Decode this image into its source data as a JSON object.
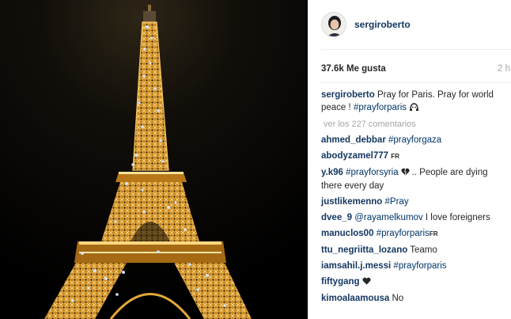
{
  "post": {
    "username": "sergiroberto",
    "likes": "37.6k Me gusta",
    "time_ago": "2 h",
    "caption": {
      "text": "Pray for Paris. Pray for world peace !",
      "hashtag": "#prayforparis"
    },
    "view_comments": "ver los 227 comentarios"
  },
  "comments": [
    {
      "user": "ahmed_debbar",
      "hashtag": "#prayforgaza",
      "text": ""
    },
    {
      "user": "abodyzamel777",
      "badge": "FR"
    },
    {
      "user": "y.k96",
      "hashtag": "#prayforsyria",
      "text": ".. People are dying there every day",
      "icon": "broken-heart-icon"
    },
    {
      "user": "justlikemenno",
      "hashtag": "#Pray"
    },
    {
      "user": "dvee_9",
      "mention": "@rayamelkumov",
      "text": "I love foreigners"
    },
    {
      "user": "manuclos00",
      "hashtag": "#prayforparis",
      "badge": "FR"
    },
    {
      "user": "ttu_negriitta_lozano",
      "text": "Teamo"
    },
    {
      "user": "iamsahil.j.messi",
      "hashtag": "#prayforparis"
    },
    {
      "user": "fiftygang",
      "icon": "black-heart-icon"
    },
    {
      "user": "kimoalaamousa",
      "text": "No"
    }
  ],
  "colors": {
    "username": "#12365f",
    "hashtag": "#003569",
    "muted": "#a5a5a5",
    "divider": "#efefef"
  }
}
